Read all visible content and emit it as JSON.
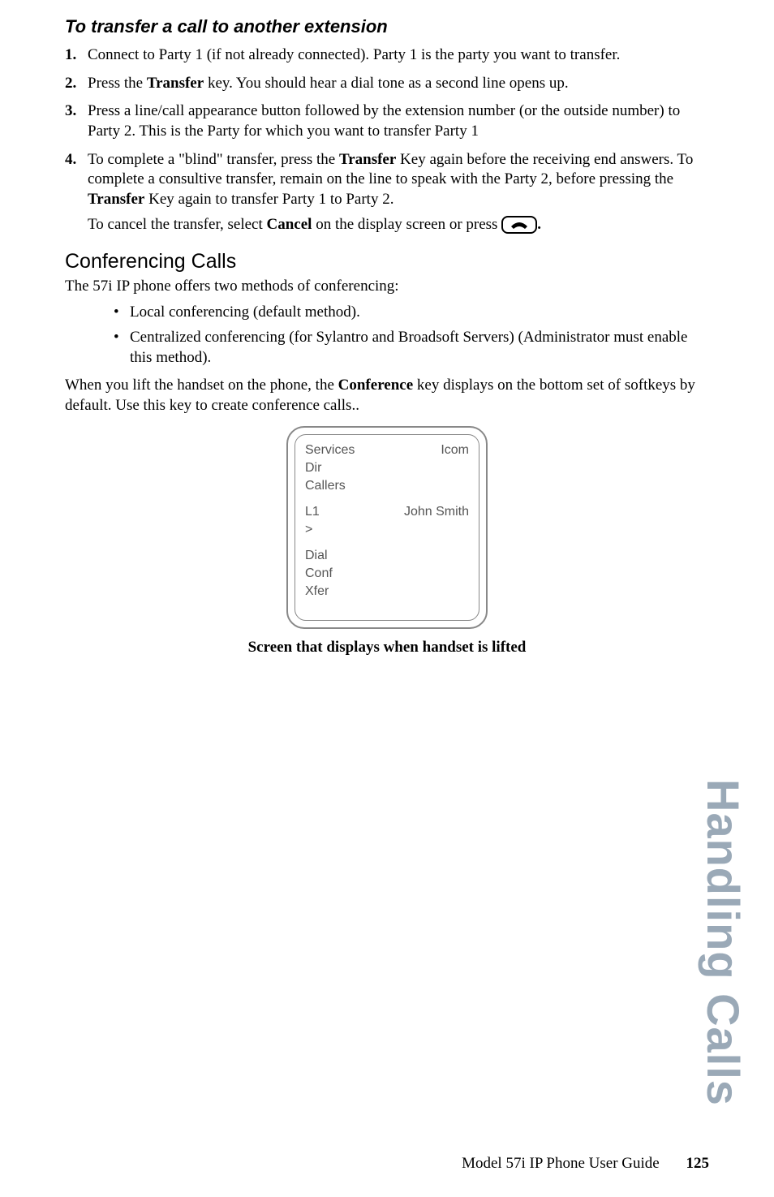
{
  "subheading1": "To transfer a call to another extension",
  "steps": [
    {
      "pre": "Connect to Party 1 (if not already connected). Party 1 is the party you want to transfer."
    },
    {
      "pre": "Press the ",
      "bold1": "Transfer",
      "mid1": " key. You should hear a dial tone as a second line opens up."
    },
    {
      "pre": "Press a line/call appearance button followed by the extension number (or the outside number) to Party 2. This is the Party for which you want to transfer Party 1"
    },
    {
      "pre": "To complete a \"blind\" transfer, press the ",
      "bold1": "Transfer",
      "mid1": " Key again before the receiving end answers. To complete a consultive transfer, remain on the line to speak with the Party 2, before pressing the ",
      "bold2": "Transfer",
      "mid2": " Key again to transfer Party 1 to Party 2."
    }
  ],
  "cancel_line": {
    "pre": "To cancel the transfer, select ",
    "bold": "Cancel",
    "post": " on the display screen or press ",
    "end": "."
  },
  "section_heading": "Conferencing Calls",
  "conf_intro": "The 57i IP phone offers two methods of conferencing:",
  "conf_bullets": [
    "Local conferencing (default method).",
    "Centralized conferencing (for Sylantro and Broadsoft Servers) (Administrator must enable this method)."
  ],
  "conf_para": {
    "pre": "When you lift the handset on the phone, the ",
    "bold": "Conference",
    "post": " key displays on the bottom set of softkeys by default. Use this key to create conference calls.."
  },
  "screen": {
    "r1_left": "Services",
    "r1_right": "Icom",
    "r2_left": "Dir",
    "r3_left": "Callers",
    "r4_left": "L1",
    "r4_right": "John Smith",
    "r5_left": ">",
    "r6_left": "Dial",
    "r7_left": "Conf",
    "r8_left": "Xfer"
  },
  "caption": "Screen that displays when handset is lifted",
  "side_tab": "Handling Calls",
  "footer_text": "Model 57i IP Phone User Guide",
  "footer_page": "125"
}
